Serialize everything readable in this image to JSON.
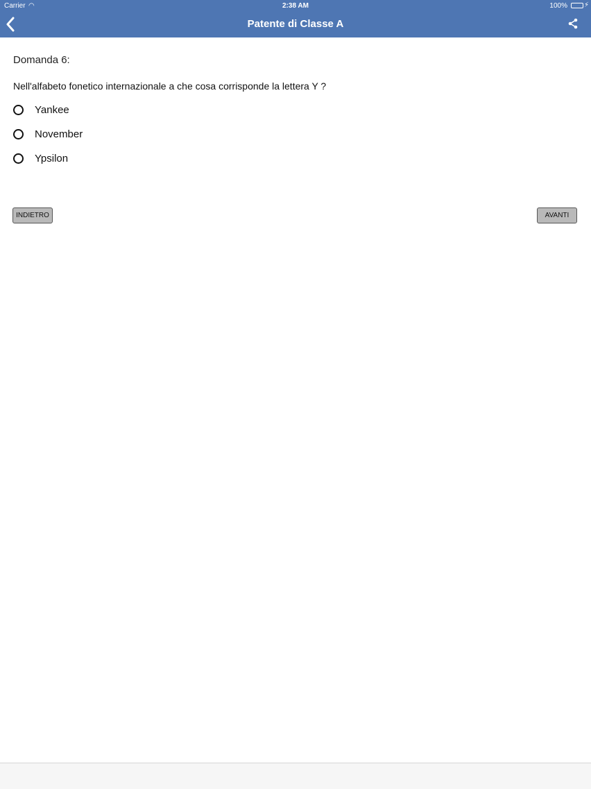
{
  "status": {
    "carrier": "Carrier",
    "time": "2:38 AM",
    "battery_percent": "100%",
    "battery_level": 1.0
  },
  "nav": {
    "title": "Patente di Classe A",
    "back_icon": "chevron-left-icon",
    "share_icon": "share-icon"
  },
  "question": {
    "number": "Domanda 6:",
    "text": "Nell'alfabeto fonetico internazionale a che cosa corrisponde la lettera Y ?",
    "options": [
      "Yankee",
      "November",
      "Ypsilon"
    ]
  },
  "buttons": {
    "prev_label": "INDIETRO",
    "next_label": "AVANTI"
  },
  "colors": {
    "navbar": "#4e76b3",
    "battery": "#4cd964",
    "button": "#b9b9b9"
  }
}
